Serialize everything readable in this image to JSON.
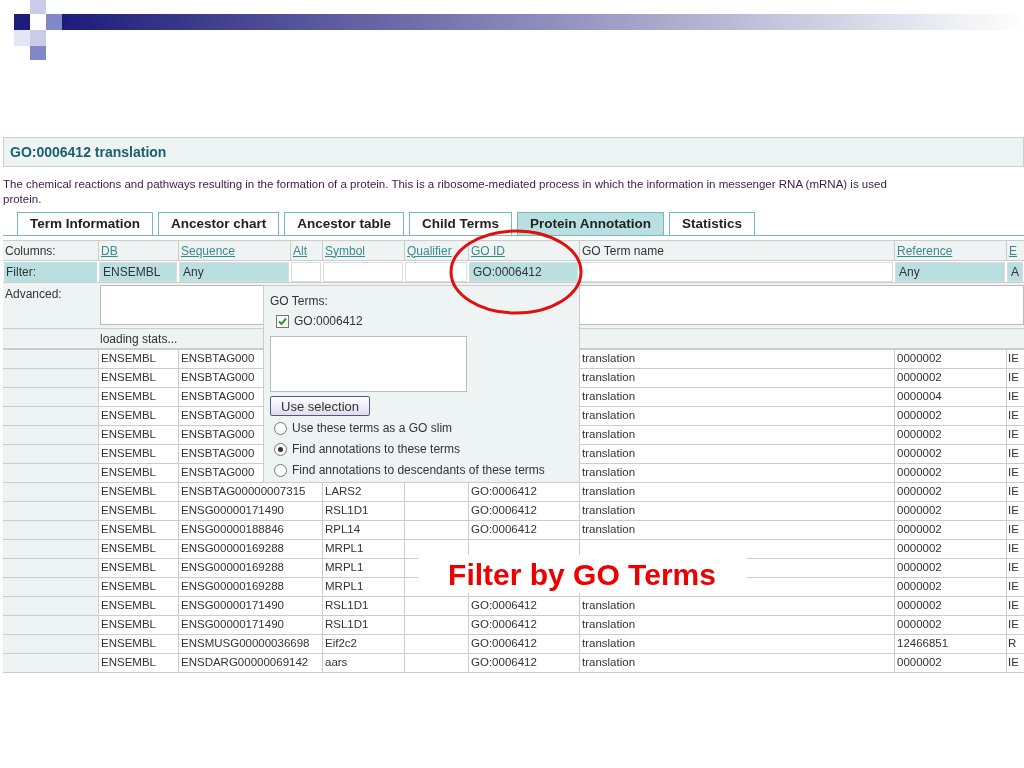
{
  "term_title": "GO:0006412 translation",
  "description_lines": [
    "The chemical reactions and pathways resulting in the formation of a protein. This is a ribosome-mediated process in which the information in messenger RNA (mRNA) is used",
    "protein."
  ],
  "tabs": [
    {
      "label": "Term Information",
      "selected": false
    },
    {
      "label": "Ancestor chart",
      "selected": false
    },
    {
      "label": "Ancestor table",
      "selected": false
    },
    {
      "label": "Child Terms",
      "selected": false
    },
    {
      "label": "Protein Annotation",
      "selected": true
    },
    {
      "label": "Statistics",
      "selected": false
    }
  ],
  "table": {
    "columns_label": "Columns:",
    "columns": [
      {
        "label": "DB",
        "link": true
      },
      {
        "label": "Sequence",
        "link": true
      },
      {
        "label": "Alt",
        "link": true
      },
      {
        "label": "Symbol",
        "link": true
      },
      {
        "label": "Qualifier",
        "link": true
      },
      {
        "label": "GO ID",
        "link": true
      },
      {
        "label": "GO Term name",
        "link": false
      },
      {
        "label": "Reference",
        "link": true
      },
      {
        "label": "E",
        "link": true
      }
    ],
    "filter_label": "Filter:",
    "filters": [
      {
        "value": "ENSEMBL",
        "active": true
      },
      {
        "value": "Any",
        "active": true
      },
      {
        "active": false
      },
      {
        "active": false
      },
      {
        "active": false
      },
      {
        "value": "GO:0006412",
        "active": true
      },
      {
        "active": false
      },
      {
        "value": "Any",
        "active": true
      },
      {
        "value": "A",
        "active": true
      }
    ],
    "advanced_label": "Advanced:",
    "status": "loading stats...",
    "rows": [
      {
        "cells": [
          "ENSEMBL",
          "ENSBTAG000",
          null,
          null,
          null,
          null,
          "translation",
          "0000002",
          "IE"
        ]
      },
      {
        "cells": [
          "ENSEMBL",
          "ENSBTAG000",
          null,
          null,
          null,
          null,
          "translation",
          "0000002",
          "IE"
        ]
      },
      {
        "cells": [
          "ENSEMBL",
          "ENSBTAG000",
          null,
          null,
          null,
          null,
          "translation",
          "0000004",
          "IE"
        ]
      },
      {
        "cells": [
          "ENSEMBL",
          "ENSBTAG000",
          null,
          null,
          null,
          null,
          "translation",
          "0000002",
          "IE"
        ]
      },
      {
        "cells": [
          "ENSEMBL",
          "ENSBTAG000",
          null,
          null,
          null,
          null,
          "translation",
          "0000002",
          "IE"
        ]
      },
      {
        "cells": [
          "ENSEMBL",
          "ENSBTAG000",
          null,
          null,
          null,
          null,
          "translation",
          "0000002",
          "IE"
        ]
      },
      {
        "cells": [
          "ENSEMBL",
          "ENSBTAG000",
          null,
          null,
          null,
          null,
          "translation",
          "0000002",
          "IE"
        ]
      },
      {
        "cells": [
          "ENSEMBL",
          "ENSBTAG00000007315",
          null,
          "LARS2",
          null,
          "GO:0006412",
          "translation",
          "0000002",
          "IE"
        ]
      },
      {
        "cells": [
          "ENSEMBL",
          "ENSG00000171490",
          null,
          "RSL1D1",
          null,
          "GO:0006412",
          "translation",
          "0000002",
          "IE"
        ]
      },
      {
        "cells": [
          "ENSEMBL",
          "ENSG00000188846",
          null,
          "RPL14",
          null,
          "GO:0006412",
          "translation",
          "0000002",
          "IE"
        ]
      },
      {
        "cells": [
          "ENSEMBL",
          "ENSG00000169288",
          null,
          "MRPL1",
          null,
          null,
          null,
          "0000002",
          "IE"
        ]
      },
      {
        "cells": [
          "ENSEMBL",
          "ENSG00000169288",
          null,
          "MRPL1",
          null,
          null,
          null,
          "0000002",
          "IE"
        ]
      },
      {
        "cells": [
          "ENSEMBL",
          "ENSG00000169288",
          null,
          "MRPL1",
          null,
          null,
          null,
          "0000002",
          "IE"
        ]
      },
      {
        "cells": [
          "ENSEMBL",
          "ENSG00000171490",
          null,
          "RSL1D1",
          null,
          "GO:0006412",
          "translation",
          "0000002",
          "IE"
        ]
      },
      {
        "cells": [
          "ENSEMBL",
          "ENSG00000171490",
          null,
          "RSL1D1",
          null,
          "GO:0006412",
          "translation",
          "0000002",
          "IE"
        ]
      },
      {
        "cells": [
          "ENSEMBL",
          "ENSMUSG00000036698",
          null,
          "Eif2c2",
          null,
          "GO:0006412",
          "translation",
          "12466851",
          "R"
        ]
      },
      {
        "cells": [
          "ENSEMBL",
          "ENSDARG00000069142",
          null,
          "aars",
          null,
          "GO:0006412",
          "translation",
          "0000002",
          "IE"
        ]
      }
    ]
  },
  "go_terms_popup": {
    "title": "GO Terms:",
    "terms": [
      {
        "id": "GO:0006412",
        "checked": true
      }
    ],
    "button": "Use selection",
    "options": [
      {
        "label": "Use these terms as a GO slim",
        "selected": false
      },
      {
        "label": "Find annotations to these terms",
        "selected": true
      },
      {
        "label": "Find annotations to descendants of these terms",
        "selected": false
      }
    ]
  },
  "callout": "Filter by GO Terms"
}
